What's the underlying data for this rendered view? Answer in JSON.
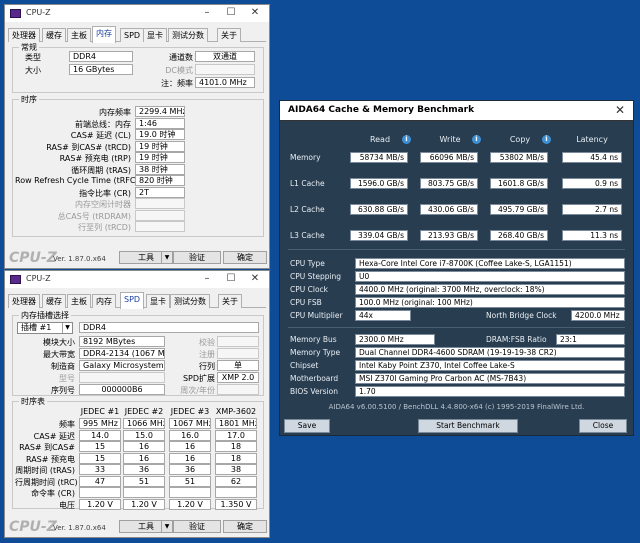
{
  "cpuz_top": {
    "title": "CPU-Z",
    "tabs": [
      "处理器",
      "缓存",
      "主板",
      "内存",
      "SPD",
      "显卡",
      "测试分数",
      "关于"
    ],
    "active_tab": 3,
    "general_label": "常规",
    "type_label": "类型",
    "type_value": "DDR4",
    "size_label": "大小",
    "size_value": "16 GBytes",
    "channels_label": "通道数",
    "channels_value": "双通道",
    "dc_label": "DC模式",
    "uncore_label": "注：频率",
    "uncore_value": "4101.0 MHz",
    "timing_label": "时序",
    "timings": [
      {
        "label": "内存频率",
        "value": "2299.4 MHz",
        "muted": false
      },
      {
        "label": "前端总线：内存",
        "value": "1:46",
        "muted": false
      },
      {
        "label": "CAS# 延迟 (CL)",
        "value": "19.0 时钟",
        "muted": false
      },
      {
        "label": "RAS# 到CAS# (tRCD)",
        "value": "19 时钟",
        "muted": false
      },
      {
        "label": "RAS# 预充电 (tRP)",
        "value": "19 时钟",
        "muted": false
      },
      {
        "label": "循环周期 (tRAS)",
        "value": "38 时钟",
        "muted": false
      },
      {
        "label": "Row Refresh Cycle Time (tRFC)",
        "value": "820 时钟",
        "muted": false
      },
      {
        "label": "指令比率 (CR)",
        "value": "2T",
        "muted": false
      },
      {
        "label": "内存空闲计时器",
        "value": "",
        "muted": true
      },
      {
        "label": "总CAS号 (tRDRAM)",
        "value": "",
        "muted": true
      },
      {
        "label": "行至列 (tRCD)",
        "value": "",
        "muted": true
      }
    ],
    "logo": "CPU-Z",
    "version": "Ver. 1.87.0.x64",
    "tools_label": "工具",
    "validate_label": "验证",
    "ok_label": "确定"
  },
  "cpuz_bot": {
    "title": "CPU-Z",
    "tabs": [
      "处理器",
      "缓存",
      "主板",
      "内存",
      "SPD",
      "显卡",
      "测试分数",
      "关于"
    ],
    "active_tab": 4,
    "slot_group_label": "内存插槽选择",
    "slot_value": "插槽 #1",
    "slot_type": "DDR4",
    "module_size_label": "模块大小",
    "module_size": "8192 MBytes",
    "max_bw_label": "最大带宽",
    "max_bw": "DDR4-2134 (1067 MHz)",
    "manufacturer_label": "制造商",
    "manufacturer": "Galaxy Microsystems Ltd.",
    "model_label": "型号",
    "serial_label": "序列号",
    "serial": "000000B6",
    "correction_label": "校验",
    "registered_label": "注册",
    "rank_label": "行列",
    "rank_value": "单",
    "spd_ext_label": "SPD扩展",
    "spd_ext": "XMP 2.0",
    "week_year_label": "周次/年份",
    "timing_table_label": "时序表",
    "jedec_cols": [
      "JEDEC #1",
      "JEDEC #2",
      "JEDEC #3",
      "XMP-3602"
    ],
    "rows": [
      {
        "label": "频率",
        "values": [
          "995 MHz",
          "1066 MHz",
          "1067 MHz",
          "1801 MHz"
        ]
      },
      {
        "label": "CAS# 延迟",
        "values": [
          "14.0",
          "15.0",
          "16.0",
          "17.0"
        ]
      },
      {
        "label": "RAS# 到CAS#",
        "values": [
          "15",
          "16",
          "16",
          "18"
        ]
      },
      {
        "label": "RAS# 预充电",
        "values": [
          "15",
          "16",
          "16",
          "18"
        ]
      },
      {
        "label": "周期时间 (tRAS)",
        "values": [
          "33",
          "36",
          "36",
          "38"
        ]
      },
      {
        "label": "行周期时间 (tRC)",
        "values": [
          "47",
          "51",
          "51",
          "62"
        ]
      },
      {
        "label": "命令率 (CR)",
        "values": [
          "",
          "",
          "",
          ""
        ]
      },
      {
        "label": "电压",
        "values": [
          "1.20 V",
          "1.20 V",
          "1.20 V",
          "1.350 V"
        ]
      }
    ],
    "logo": "CPU-Z",
    "version": "Ver. 1.87.0.x64",
    "tools_label": "工具",
    "validate_label": "验证",
    "ok_label": "确定"
  },
  "aida": {
    "title": "AIDA64 Cache & Memory Benchmark",
    "close": "✕",
    "cols": [
      "Read",
      "Write",
      "Copy",
      "Latency"
    ],
    "bench": [
      {
        "label": "Memory",
        "values": [
          "58734 MB/s",
          "66096 MB/s",
          "53802 MB/s",
          "45.4 ns"
        ]
      },
      {
        "label": "L1 Cache",
        "values": [
          "1596.0 GB/s",
          "803.75 GB/s",
          "1601.8 GB/s",
          "0.9 ns"
        ]
      },
      {
        "label": "L2 Cache",
        "values": [
          "630.88 GB/s",
          "430.06 GB/s",
          "495.79 GB/s",
          "2.7 ns"
        ]
      },
      {
        "label": "L3 Cache",
        "values": [
          "339.04 GB/s",
          "213.93 GB/s",
          "268.40 GB/s",
          "11.3 ns"
        ]
      }
    ],
    "cpu_type_label": "CPU Type",
    "cpu_type": "Hexa-Core Intel Core i7-8700K  (Coffee Lake-S, LGA1151)",
    "cpu_stepping_label": "CPU Stepping",
    "cpu_stepping": "U0",
    "cpu_clock_label": "CPU Clock",
    "cpu_clock": "4400.0 MHz  (original: 3700 MHz, overclock: 18%)",
    "cpu_fsb_label": "CPU FSB",
    "cpu_fsb": "100.0 MHz  (original: 100 MHz)",
    "cpu_mult_label": "CPU Multiplier",
    "cpu_mult": "44x",
    "nb_clock_label": "North Bridge Clock",
    "nb_clock": "4200.0 MHz",
    "mem_bus_label": "Memory Bus",
    "mem_bus": "2300.0 MHz",
    "dram_ratio_label": "DRAM:FSB Ratio",
    "dram_ratio": "23:1",
    "mem_type_label": "Memory Type",
    "mem_type": "Dual Channel DDR4-4600 SDRAM  (19-19-19-38 CR2)",
    "chipset_label": "Chipset",
    "chipset": "Intel Kaby Point Z370, Intel Coffee Lake-S",
    "mobo_label": "Motherboard",
    "mobo": "MSI Z370I Gaming Pro Carbon AC (MS-7B43)",
    "bios_label": "BIOS Version",
    "bios": "1.70",
    "footer": "AIDA64 v6.00.5100 / BenchDLL 4.4.800-x64  (c) 1995-2019 FinalWire Ltd.",
    "save_label": "Save",
    "start_label": "Start Benchmark",
    "close_label": "Close"
  }
}
